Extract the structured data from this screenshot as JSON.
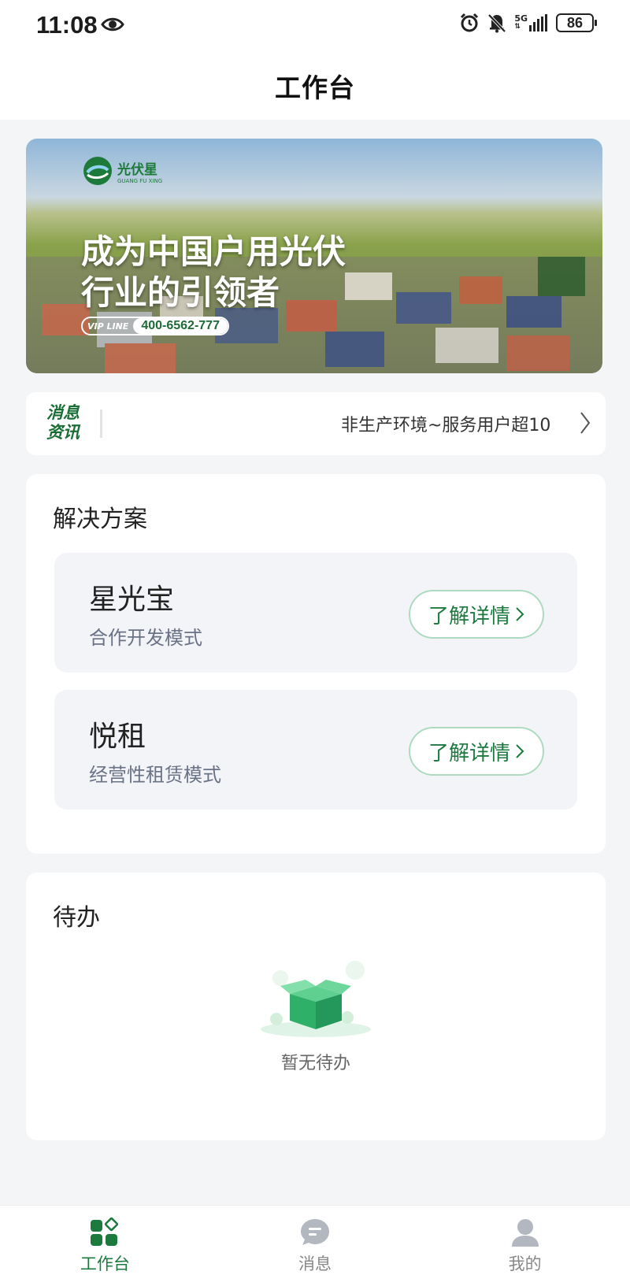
{
  "status": {
    "time": "11:08",
    "network": "5G",
    "battery": "86"
  },
  "header": {
    "title": "工作台"
  },
  "banner": {
    "brand": "光伏星",
    "brand_sub": "GUANG FU XING",
    "headline_line1": "成为中国户用光伏",
    "headline_line2": "行业的引领者",
    "vip_label": "VIP LINE",
    "phone": "400-6562-777"
  },
  "news": {
    "badge_line1": "消息",
    "badge_line2": "资讯",
    "text": "非生产环境~服务用户超10"
  },
  "solutions": {
    "title": "解决方案",
    "items": [
      {
        "name": "星光宝",
        "desc": "合作开发模式",
        "button": "了解详情"
      },
      {
        "name": "悦租",
        "desc": "经营性租赁模式",
        "button": "了解详情"
      }
    ]
  },
  "todo": {
    "title": "待办",
    "empty": "暂无待办"
  },
  "tabbar": {
    "items": [
      {
        "label": "工作台",
        "icon": "workbench-icon",
        "active": true
      },
      {
        "label": "消息",
        "icon": "message-icon",
        "active": false
      },
      {
        "label": "我的",
        "icon": "profile-icon",
        "active": false
      }
    ]
  },
  "colors": {
    "accent": "#1c7a3e",
    "background": "#f4f5f7",
    "card": "#ffffff"
  }
}
